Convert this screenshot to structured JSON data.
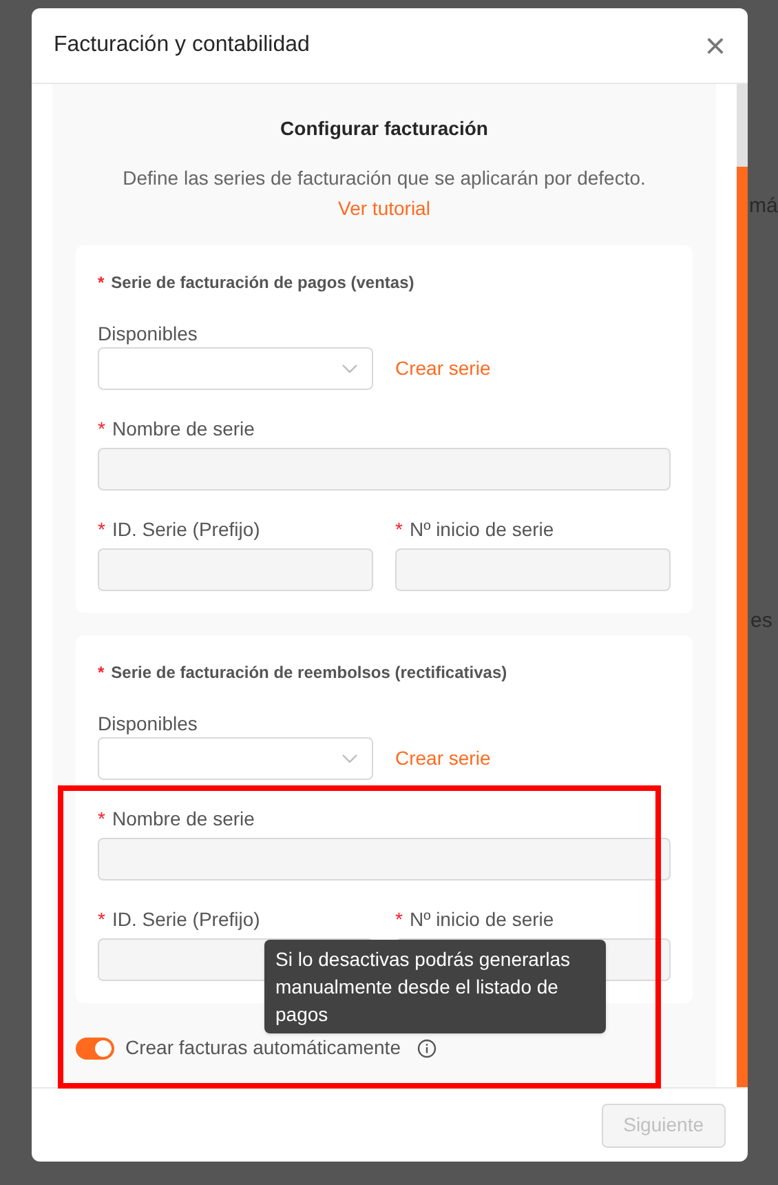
{
  "background_fragments": [
    "má",
    "es"
  ],
  "dialog": {
    "title": "Facturación y contabilidad",
    "close": "×"
  },
  "heading": "Configurar facturación",
  "description": "Define las series de facturación que se aplicarán por defecto.",
  "tutorial_link": "Ver tutorial",
  "sections": [
    {
      "required_marks": [
        "*",
        "*",
        "*",
        "*"
      ],
      "title": "Serie de facturación de pagos (ventas)",
      "select_label": "Disponibles",
      "create_link": "Crear serie",
      "name_label": "Nombre de serie",
      "id_label": "ID. Serie (Prefijo)",
      "start_label": "Nº inicio de serie"
    },
    {
      "required_marks": [
        "*",
        "*",
        "*",
        "*"
      ],
      "title": "Serie de facturación de reembolsos (rectificativas)",
      "select_label": "Disponibles",
      "create_link": "Crear serie",
      "name_label": "Nombre de serie",
      "id_label": "ID. Serie (Prefijo)",
      "start_label": "Nº inicio de serie"
    }
  ],
  "auto_invoice": {
    "label": "Crear facturas automáticamente",
    "on": true,
    "tooltip": "Si lo desactivas podrás generarlas manualmente desde el listado de pagos"
  },
  "footer": {
    "next_button": {
      "label": "Siguiente",
      "disabled": true
    }
  }
}
